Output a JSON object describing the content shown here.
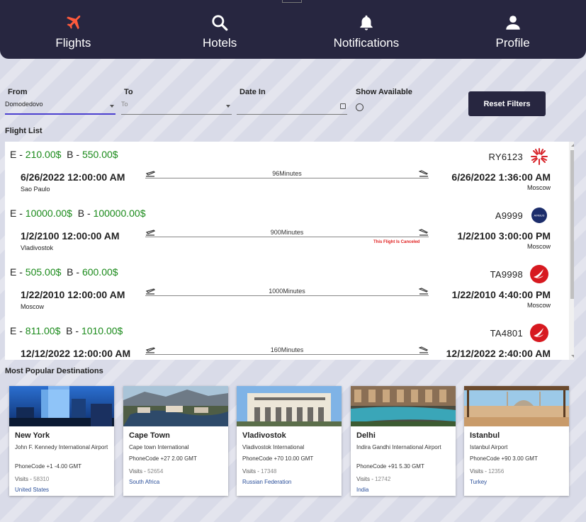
{
  "nav": {
    "items": [
      {
        "label": "Flights",
        "icon": "plane-icon",
        "color": "#ff5a3c"
      },
      {
        "label": "Hotels",
        "icon": "search-icon"
      },
      {
        "label": "Notifications",
        "icon": "bell-icon"
      },
      {
        "label": "Profile",
        "icon": "user-icon"
      }
    ]
  },
  "filters": {
    "from_label": "From",
    "from_value": "Domodedovo",
    "to_label": "To",
    "to_placeholder": "To",
    "date_label": "Date In",
    "show_available_label": "Show Available",
    "reset_label": "Reset Filters"
  },
  "flight_list_title": "Flight List",
  "flights": [
    {
      "economy": "210.00$",
      "business": "550.00$",
      "code": "RY6123",
      "airline_icon": "red-airline-logo",
      "dep_time": "6/26/2022 12:00:00 AM",
      "dep_city": "Sao Paulo",
      "arr_time": "6/26/2022 1:36:00 AM",
      "arr_city": "Moscow",
      "duration": "96Minutes",
      "status": ""
    },
    {
      "economy": "10000.00$",
      "business": "100000.00$",
      "code": "A9999",
      "airline_icon": "airbus-logo",
      "dep_time": "1/2/2100 12:00:00 AM",
      "dep_city": "Vladivostok",
      "arr_time": "1/2/2100 3:00:00 PM",
      "arr_city": "Moscow",
      "duration": "900Minutes",
      "status": "This Flight Is Canceled"
    },
    {
      "economy": "505.00$",
      "business": "600.00$",
      "code": "TA9998",
      "airline_icon": "turkish-airlines-logo",
      "dep_time": "1/22/2010 12:00:00 AM",
      "dep_city": "Moscow",
      "arr_time": "1/22/2010 4:40:00 PM",
      "arr_city": "Moscow",
      "duration": "1000Minutes",
      "status": ""
    },
    {
      "economy": "811.00$",
      "business": "1010.00$",
      "code": "TA4801",
      "airline_icon": "turkish-airlines-logo",
      "dep_time": "12/12/2022 12:00:00 AM",
      "dep_city": "",
      "arr_time": "12/12/2022 2:40:00 AM",
      "arr_city": "",
      "duration": "160Minutes",
      "status": ""
    }
  ],
  "price_labels": {
    "economy": "E - ",
    "business": "B - "
  },
  "destinations_title": "Most Popular Destinations",
  "destinations": [
    {
      "city": "New York",
      "airport": "John F. Kennedy International Airport",
      "phone": "PhoneCode +1  -4.00 GMT",
      "visits_label": "Visits - ",
      "visits": "58310",
      "country": "United States"
    },
    {
      "city": "Cape Town",
      "airport": "Cape town International",
      "phone": "PhoneCode +27  2.00 GMT",
      "visits_label": "Visits - ",
      "visits": "52654",
      "country": "South Africa"
    },
    {
      "city": "Vladivostok",
      "airport": "Vladivostok International",
      "phone": "PhoneCode +70  10.00 GMT",
      "visits_label": "Visits - ",
      "visits": "17348",
      "country": "Russian Federation"
    },
    {
      "city": "Delhi",
      "airport": "Indira Gandhi International Airport",
      "phone": "PhoneCode +91  5.30 GMT",
      "visits_label": "Visits - ",
      "visits": "12742",
      "country": "India"
    },
    {
      "city": "Istanbul",
      "airport": "Istanbul Airport",
      "phone": "PhoneCode +90  3.00 GMT",
      "visits_label": "Visits - ",
      "visits": "12356",
      "country": "Turkey"
    }
  ],
  "colors": {
    "nav_bg": "#272640",
    "price_green": "#1a8a1a",
    "cancel_red": "#e02020",
    "country_blue": "#2a4f9a"
  }
}
